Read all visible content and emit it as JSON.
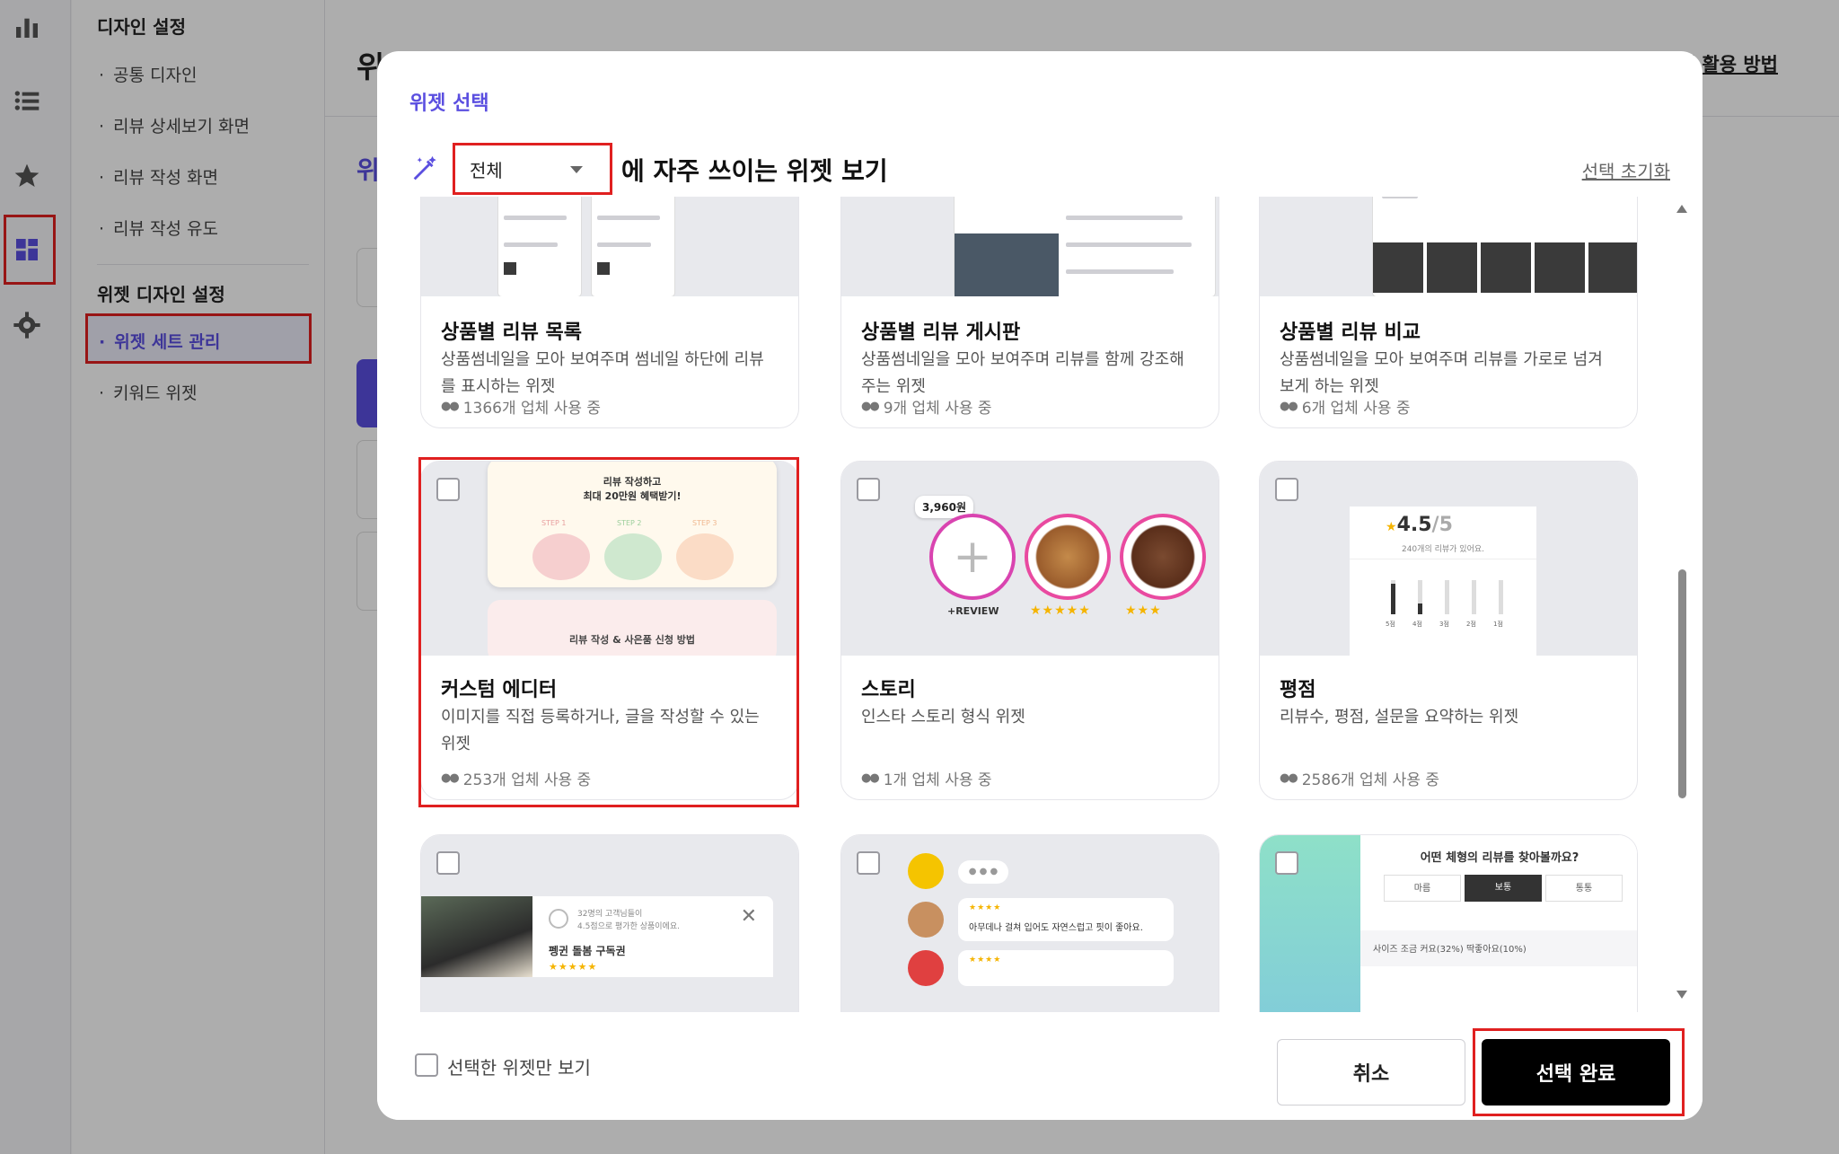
{
  "sidebar_rail": {
    "icons": [
      "bar-chart-icon",
      "list-icon",
      "star-icon",
      "widget-grid-icon",
      "gear-icon"
    ]
  },
  "subnav": {
    "design_group_title": "디자인 설정",
    "design_items": [
      "공통 디자인",
      "리뷰 상세보기 화면",
      "리뷰 작성 화면",
      "리뷰 작성 유도"
    ],
    "widget_group_title": "위젯 디자인 설정",
    "widget_items": [
      "위젯 세트 관리",
      "키워드 위젯"
    ]
  },
  "background": {
    "page_title": "위",
    "guide_link": "젯 활용 방법",
    "section_title": "위"
  },
  "modal": {
    "title": "위젯 선택",
    "filter_select_value": "전체",
    "filter_suffix": "에 자주 쓰이는 위젯 보기",
    "reset_link": "선택 초기화",
    "cards": [
      {
        "title": "상품별 리뷰 목록",
        "desc": "상품썸네일을 모아 보여주며 썸네일 하단에 리뷰를 표시하는 위젯",
        "usage": "1366개 업체 사용 중"
      },
      {
        "title": "상품별 리뷰 게시판",
        "desc": "상품썸네일을 모아 보여주며 리뷰를 함께 강조해주는 위젯",
        "usage": "9개 업체 사용 중"
      },
      {
        "title": "상품별 리뷰 비교",
        "desc": "상품썸네일을 모아 보여주며 리뷰를 가로로 넘겨보게 하는 위젯",
        "usage": "6개 업체 사용 중"
      },
      {
        "title": "커스텀 에디터",
        "desc": "이미지를 직접 등록하거나, 글을 작성할 수 있는 위젯",
        "usage": "253개 업체 사용 중",
        "thumb": {
          "headline": "리뷰 작성하고",
          "headline2": "최대 20만원 혜택받기!",
          "steps": [
            "STEP 1",
            "STEP 2",
            "STEP 3"
          ],
          "bottom": "리뷰 작성 & 사은품 신청 방법"
        }
      },
      {
        "title": "스토리",
        "desc": "인스타 스토리 형식 위젯",
        "usage": "1개 업체 사용 중",
        "thumb": {
          "price": "3,960원",
          "review": "+REVIEW"
        }
      },
      {
        "title": "평점",
        "desc": "리뷰수, 평점, 설문을 요약하는 위젯",
        "usage": "2586개 업체 사용 중",
        "thumb": {
          "score": "4.5",
          "out_of": "/5",
          "count": "240개의 리뷰가 있어요.",
          "bars": [
            "5점",
            "4점",
            "3점",
            "2점",
            "1점"
          ]
        }
      },
      {
        "thumb": {
          "line1": "32명의 고객님들이",
          "line2": "4.5점으로 평가한 상품이에요.",
          "product": "펭귄 돌봄 구독권"
        }
      },
      {
        "thumb": {
          "comment": "아무데나 걸쳐 입어도 자연스럽고 핏이 좋아요."
        }
      },
      {
        "thumb": {
          "question": "어떤 체형의 리뷰를 찾아볼까요?",
          "options": [
            "마름",
            "보통",
            "통통"
          ],
          "note": "사이즈 조금 커요(32%) 딱좋아요(10%)"
        }
      }
    ],
    "only_selected_label": "선택한 위젯만 보기",
    "cancel_label": "취소",
    "done_label": "선택 완료"
  }
}
